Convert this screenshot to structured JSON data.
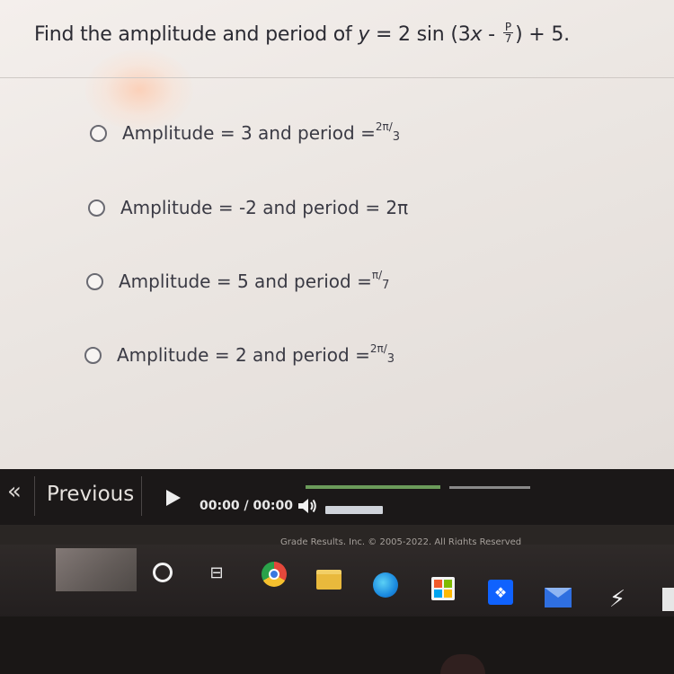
{
  "question": {
    "prefix": "Find the amplitude and period of ",
    "var_y": "y",
    "mid": " = 2 sin (3",
    "var_x": "x",
    "minus": " - ",
    "frac_num": "P",
    "frac_den": "7",
    "suffix": ") + 5."
  },
  "options": [
    {
      "text": "Amplitude = 3 and period = ",
      "sup": "2π",
      "slash": "/",
      "sub": "3"
    },
    {
      "text": "Amplitude = -2 and period = 2π",
      "sup": "",
      "slash": "",
      "sub": ""
    },
    {
      "text": "Amplitude = 5 and period = ",
      "sup": "π",
      "slash": "/",
      "sub": "7"
    },
    {
      "text": "Amplitude = 2 and period = ",
      "sup": "2π",
      "slash": "/",
      "sub": "3"
    }
  ],
  "toolbar": {
    "back_arrows": "«",
    "previous_label": "Previous",
    "time_current": "00:00",
    "time_separator": "/",
    "time_total": "00:00",
    "volume_level": 1.0
  },
  "footer": {
    "copyright": "Grade Results, Inc. © 2005-2022. All Rights Reserved"
  },
  "taskbar_icons": [
    "cortana-icon",
    "task-view-icon",
    "chrome-icon",
    "file-explorer-icon",
    "edge-icon",
    "store-icon",
    "dropbox-icon",
    "mail-icon",
    "slash-app-icon"
  ]
}
